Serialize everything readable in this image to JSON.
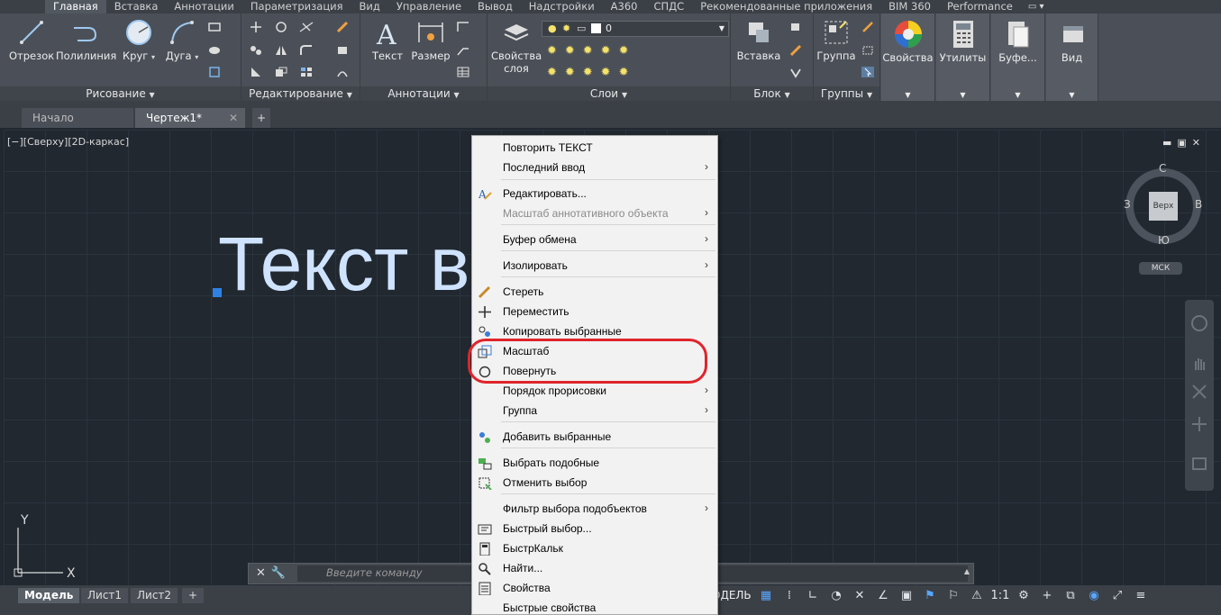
{
  "ribbon_tabs": [
    "Главная",
    "Вставка",
    "Аннотации",
    "Параметризация",
    "Вид",
    "Управление",
    "Вывод",
    "Надстройки",
    "А360",
    "СПДС",
    "Рекомендованные приложения",
    "BIM 360",
    "Performance"
  ],
  "panels": {
    "draw": {
      "title": "Рисование",
      "buttons": [
        "Отрезок",
        "Полилиния",
        "Круг",
        "Дуга"
      ]
    },
    "modify": {
      "title": "Редактирование"
    },
    "annotation": {
      "title": "Аннотации",
      "buttons": [
        "Текст",
        "Размер"
      ]
    },
    "layers": {
      "title": "Слои",
      "button": "Свойства слоя",
      "layer_value": "0"
    },
    "block": {
      "title": "Блок",
      "button": "Вставка"
    },
    "groups": {
      "title": "Группы",
      "button": "Группа"
    },
    "tiles": [
      "Свойства",
      "Утилиты",
      "Буфе...",
      "Вид"
    ]
  },
  "file_tabs": {
    "home": "Начало",
    "doc": "Чертеж1*",
    "close": "✕",
    "plus": "+"
  },
  "viewport_label": "[−][Сверху][2D-каркас]",
  "drawing_text": "Текст в ...каде",
  "viewcube": {
    "face": "Верх",
    "n": "С",
    "s": "Ю",
    "w": "З",
    "e": "В",
    "ucs": "МСК"
  },
  "ucs_axes": {
    "x": "X",
    "y": "Y"
  },
  "command_line": {
    "placeholder": "Введите команду"
  },
  "status": {
    "tabs": [
      "Модель",
      "Лист1",
      "Лист2"
    ],
    "plus": "+",
    "mode": "ОДЕЛЬ",
    "scale": "1:1"
  },
  "context_menu": [
    {
      "label": "Повторить ТЕКСТ",
      "icon": "",
      "sub": false
    },
    {
      "label": "Последний ввод",
      "icon": "",
      "sub": true
    },
    {
      "label": "Редактировать...",
      "icon": "edit-text-icon",
      "sub": false
    },
    {
      "label": "Масштаб аннотативного объекта",
      "icon": "",
      "sub": true,
      "disabled": true
    },
    {
      "label": "Буфер обмена",
      "icon": "",
      "sub": true
    },
    {
      "label": "Изолировать",
      "icon": "",
      "sub": true
    },
    {
      "label": "Стереть",
      "icon": "eraser-icon",
      "sub": false
    },
    {
      "label": "Переместить",
      "icon": "move-icon",
      "sub": false
    },
    {
      "label": "Копировать выбранные",
      "icon": "copy-icon",
      "sub": false
    },
    {
      "label": "Масштаб",
      "icon": "scale-icon",
      "sub": false
    },
    {
      "label": "Повернуть",
      "icon": "rotate-icon",
      "sub": false
    },
    {
      "label": "Порядок прорисовки",
      "icon": "",
      "sub": true
    },
    {
      "label": "Группа",
      "icon": "",
      "sub": true
    },
    {
      "label": "Добавить выбранные",
      "icon": "add-selected-icon",
      "sub": false
    },
    {
      "label": "Выбрать подобные",
      "icon": "select-similar-icon",
      "sub": false
    },
    {
      "label": "Отменить выбор",
      "icon": "deselect-icon",
      "sub": false
    },
    {
      "label": "Фильтр выбора подобъектов",
      "icon": "",
      "sub": true
    },
    {
      "label": "Быстрый выбор...",
      "icon": "quick-select-icon",
      "sub": false
    },
    {
      "label": "БыстрКальк",
      "icon": "calculator-icon",
      "sub": false
    },
    {
      "label": "Найти...",
      "icon": "find-icon",
      "sub": false
    },
    {
      "label": "Свойства",
      "icon": "properties-icon",
      "sub": false
    },
    {
      "label": "Быстрые свойства",
      "icon": "",
      "sub": false
    }
  ],
  "submenu_arrow": "›",
  "colors": {
    "canvas": "#212830",
    "highlight": "#e0242c",
    "grip": "#2e82e6",
    "text": "#cfe3ff"
  }
}
